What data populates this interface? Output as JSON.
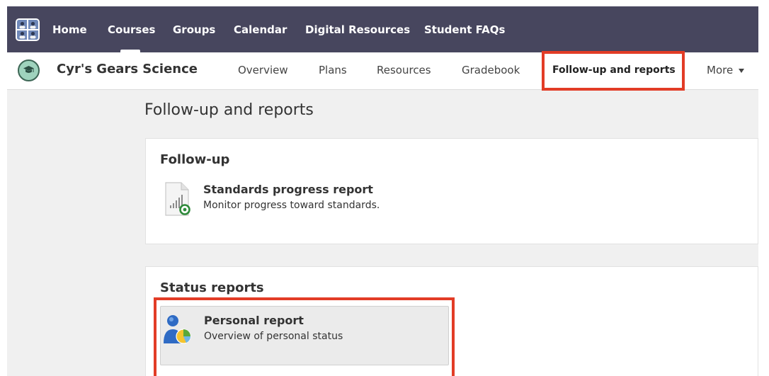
{
  "top_nav": {
    "logo_icon": "school-people-logo-icon",
    "links": [
      {
        "label": "Home"
      },
      {
        "label": "Courses"
      },
      {
        "label": "Groups"
      },
      {
        "label": "Calendar"
      },
      {
        "label": "Digital Resources"
      },
      {
        "label": "Student FAQs"
      }
    ],
    "active": "Courses"
  },
  "course_bar": {
    "course_icon": "graduation-cap-icon",
    "course_title": "Cyr's Gears Science",
    "tabs": [
      {
        "label": "Overview"
      },
      {
        "label": "Plans"
      },
      {
        "label": "Resources"
      },
      {
        "label": "Gradebook"
      },
      {
        "label": "Follow-up and reports"
      },
      {
        "label": "More"
      }
    ],
    "active_tab": "Follow-up and reports"
  },
  "main": {
    "page_title": "Follow-up and reports",
    "followup": {
      "title": "Follow-up",
      "items": [
        {
          "icon": "standards-progress-report-icon",
          "title": "Standards progress report",
          "description": "Monitor progress toward standards."
        }
      ]
    },
    "status": {
      "title": "Status reports",
      "items": [
        {
          "icon": "personal-report-icon",
          "title": "Personal report",
          "description": "Overview of personal status"
        }
      ]
    }
  },
  "colors": {
    "top_nav_bg": "#47465e",
    "highlight": "#e23c26",
    "page_bg": "#f0f0f0",
    "card_bg": "#ffffff"
  }
}
